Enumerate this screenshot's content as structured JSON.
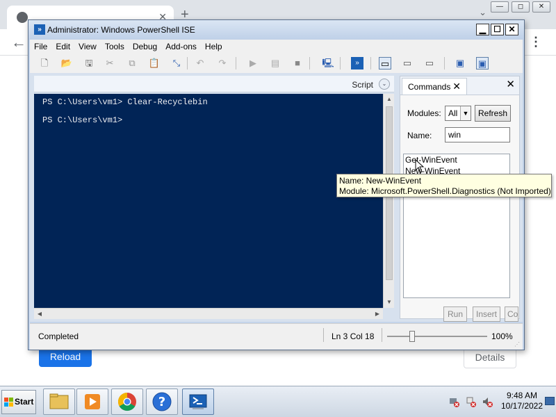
{
  "browser": {
    "reload_label": "Reload",
    "details_label": "Details"
  },
  "window": {
    "title": "Administrator: Windows PowerShell ISE"
  },
  "menu": [
    "File",
    "Edit",
    "View",
    "Tools",
    "Debug",
    "Add-ons",
    "Help"
  ],
  "toolbar": {
    "icons": [
      "new-file-icon",
      "open-folder-icon",
      "save-icon",
      "cut-icon",
      "copy-icon",
      "paste-icon",
      "clear-icon",
      "undo-icon",
      "redo-icon",
      "run-icon",
      "run-selection-icon",
      "stop-icon",
      "remote-powershell-icon",
      "powershell-console-icon",
      "show-script-top-icon",
      "show-script-right-icon",
      "show-script-max-icon",
      "show-command-window-icon",
      "show-command-addon-icon"
    ]
  },
  "script_pane": {
    "label": "Script"
  },
  "console": {
    "lines": [
      "PS C:\\Users\\vm1> Clear-Recyclebin",
      "PS C:\\Users\\vm1>"
    ]
  },
  "commands": {
    "tab_label": "Commands",
    "modules_label": "Modules:",
    "modules_value": "All",
    "refresh_label": "Refresh",
    "name_label": "Name:",
    "name_value": "win",
    "items": [
      "Get-WinEvent",
      "New-WinEvent"
    ],
    "run_label": "Run",
    "insert_label": "Insert",
    "copy_label": "Co"
  },
  "tooltip": {
    "name_line": "Name: New-WinEvent",
    "module_line": "Module: Microsoft.PowerShell.Diagnostics (Not Imported)"
  },
  "statusbar": {
    "status": "Completed",
    "position": "Ln 3  Col 18",
    "zoom": "100%",
    "zoom_level": 0.25
  },
  "taskbar": {
    "start_label": "Start",
    "apps": [
      "file-explorer-icon",
      "media-player-icon",
      "chrome-icon",
      "help-icon",
      "powershell-ise-icon"
    ],
    "time": "9:48 AM",
    "date": "10/17/2022"
  },
  "colors": {
    "console_bg": "#012456",
    "accent_blue": "#1a73e8",
    "tooltip_bg": "#ffffe1"
  }
}
